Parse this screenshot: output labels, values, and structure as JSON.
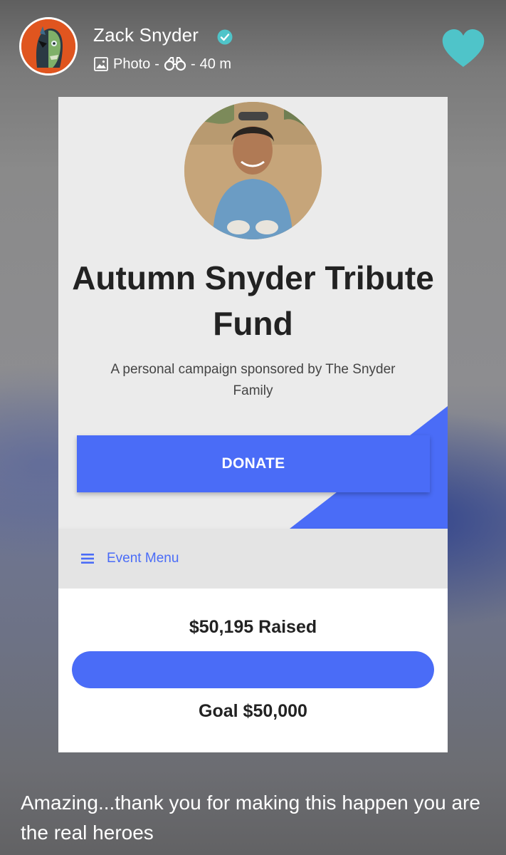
{
  "post": {
    "author": "Zack Snyder",
    "media_type": "Photo",
    "separator": "-",
    "age": "40 m",
    "liked": true,
    "accent_color": "#4fc4c9",
    "caption": "Amazing...thank you for making this happen you are the real heroes"
  },
  "icons": {
    "verified": "verified-check-icon",
    "photo": "photo-icon",
    "views": "binoculars-icon",
    "like": "heart-icon",
    "menu": "hamburger-menu-icon"
  },
  "campaign": {
    "title": "Autumn Snyder Tribute Fund",
    "subtitle": "A personal campaign sponsored by The Snyder Family",
    "donate_label": "DONATE",
    "menu_label": "Event Menu",
    "raised_label": "$50,195 Raised",
    "goal_label": "Goal $50,000",
    "raised_amount": 50195,
    "goal_amount": 50000,
    "progress_fraction": 1.0,
    "brand_color": "#4a6cf7"
  }
}
